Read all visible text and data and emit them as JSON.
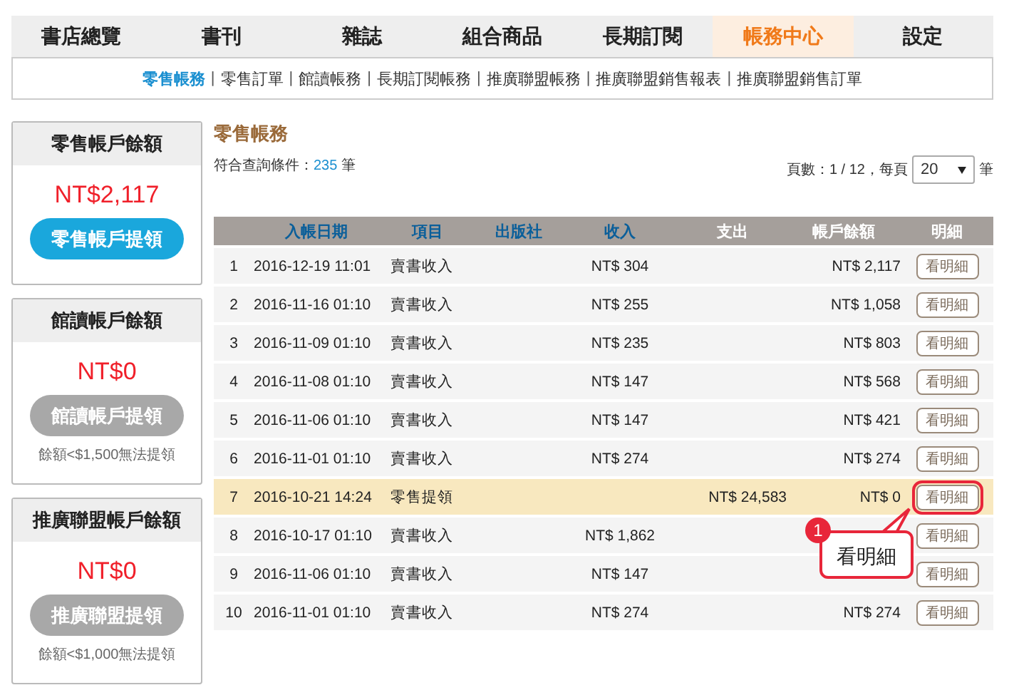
{
  "nav": {
    "tabs": [
      {
        "label": "書店總覽",
        "selected": false
      },
      {
        "label": "書刊",
        "selected": false
      },
      {
        "label": "雜誌",
        "selected": false
      },
      {
        "label": "組合商品",
        "selected": false
      },
      {
        "label": "長期訂閱",
        "selected": false
      },
      {
        "label": "帳務中心",
        "selected": true
      },
      {
        "label": "設定",
        "selected": false
      }
    ]
  },
  "subnav_separator": "|",
  "subnav": [
    {
      "label": "零售帳務",
      "selected": true
    },
    {
      "label": "零售訂單",
      "selected": false
    },
    {
      "label": "館讀帳務",
      "selected": false
    },
    {
      "label": "長期訂閱帳務",
      "selected": false
    },
    {
      "label": "推廣聯盟帳務",
      "selected": false
    },
    {
      "label": "推廣聯盟銷售報表",
      "selected": false
    },
    {
      "label": "推廣聯盟銷售訂單",
      "selected": false
    }
  ],
  "cards": [
    {
      "title": "零售帳戶餘額",
      "amount": "NT$2,117",
      "button": "零售帳戶提領",
      "disabled": false
    },
    {
      "title": "館讀帳戶餘額",
      "amount": "NT$0",
      "button": "館讀帳戶提領",
      "disabled": true,
      "note": "餘額<$1,500無法提領"
    },
    {
      "title": "推廣聯盟帳戶餘額",
      "amount": "NT$0",
      "button": "推廣聯盟提領",
      "disabled": true,
      "note": "餘額<$1,000無法提領"
    }
  ],
  "section_title": "零售帳務",
  "result": {
    "label": "符合查詢條件：",
    "count": "235",
    "unit": "筆"
  },
  "pagination": {
    "label": "頁數：1 / 12，每頁",
    "per_page": "20",
    "unit": "筆"
  },
  "table": {
    "columns": [
      {
        "label": "入帳日期",
        "link": true
      },
      {
        "label": "項目",
        "link": true
      },
      {
        "label": "出版社",
        "link": true
      },
      {
        "label": "收入",
        "link": true
      },
      {
        "label": "支出",
        "link": false
      },
      {
        "label": "帳戶餘額",
        "link": false
      },
      {
        "label": "明細",
        "link": false
      }
    ],
    "rows": [
      {
        "no": "1",
        "date": "2016-12-19 11:01",
        "item": "賣書收入",
        "income": "NT$ 304",
        "balance": "NT$ 2,117",
        "detail": "看明細",
        "selected": false
      },
      {
        "no": "2",
        "date": "2016-11-16 01:10",
        "item": "賣書收入",
        "income": "NT$ 255",
        "balance": "NT$ 1,058",
        "detail": "看明細",
        "selected": false
      },
      {
        "no": "3",
        "date": "2016-11-09 01:10",
        "item": "賣書收入",
        "income": "NT$ 235",
        "balance": "NT$ 803",
        "detail": "看明細",
        "selected": false
      },
      {
        "no": "4",
        "date": "2016-11-08 01:10",
        "item": "賣書收入",
        "income": "NT$ 147",
        "balance": "NT$ 568",
        "detail": "看明細",
        "selected": false
      },
      {
        "no": "5",
        "date": "2016-11-06 01:10",
        "item": "賣書收入",
        "income": "NT$ 147",
        "balance": "NT$ 421",
        "detail": "看明細",
        "selected": false
      },
      {
        "no": "6",
        "date": "2016-11-01 01:10",
        "item": "賣書收入",
        "income": "NT$ 274",
        "balance": "NT$ 274",
        "detail": "看明細",
        "selected": false
      },
      {
        "no": "7",
        "date": "2016-10-21 14:24",
        "item": "零售提領",
        "expense": "NT$ 24,583",
        "balance": "NT$ 0",
        "detail": "看明細",
        "selected": true
      },
      {
        "no": "8",
        "date": "2016-10-17 01:10",
        "item": "賣書收入",
        "income": "NT$ 1,862",
        "detail": "看明細",
        "selected": false
      },
      {
        "no": "9",
        "date": "2016-11-06 01:10",
        "item": "賣書收入",
        "income": "NT$ 147",
        "detail": "看明細",
        "selected": false
      },
      {
        "no": "10",
        "date": "2016-11-01 01:10",
        "item": "賣書收入",
        "income": "NT$ 274",
        "balance": "NT$ 274",
        "detail": "看明細",
        "selected": false
      }
    ]
  },
  "callout": {
    "number": "1",
    "text": "看明細"
  }
}
